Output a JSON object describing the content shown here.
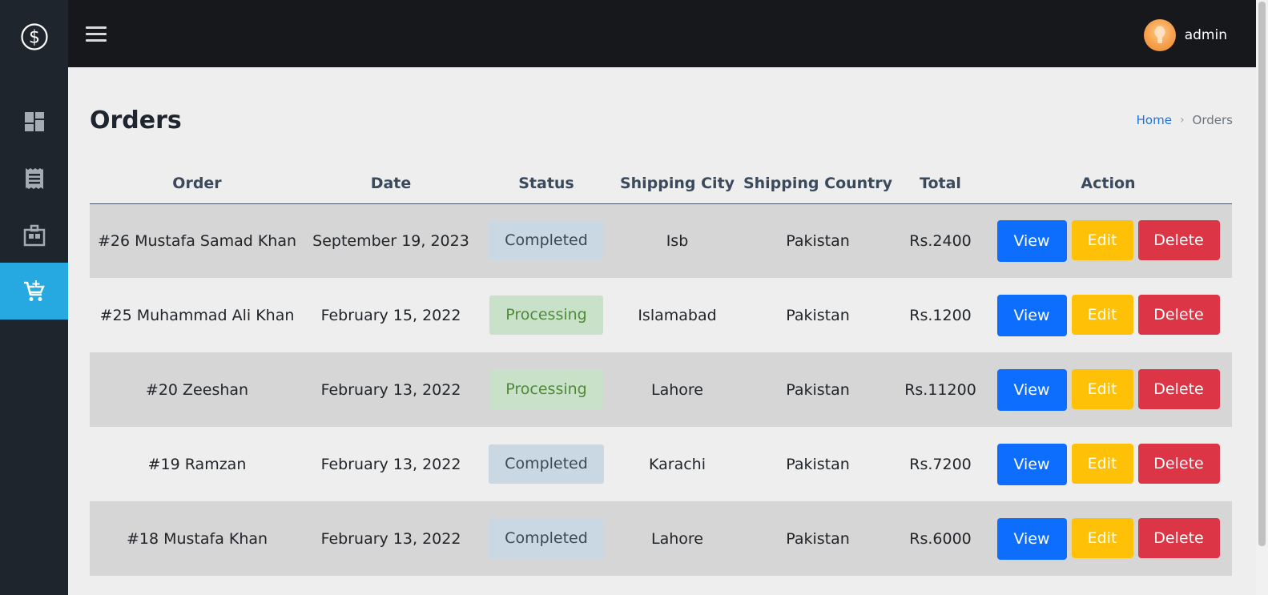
{
  "colors": {
    "sidebar": "#1f252d",
    "sidebar_active": "#26a9e0",
    "topbar": "#16181c",
    "view_button": "#0d6efd",
    "edit_button": "#ffc107",
    "delete_button": "#dc3545",
    "completed_badge": "#c9d8e3",
    "processing_badge": "#c9e1c9"
  },
  "sidebar": {
    "logo_icon": "dollar-circle-icon",
    "items": [
      {
        "icon": "dashboard-icon",
        "active": false
      },
      {
        "icon": "receipt-icon",
        "active": false
      },
      {
        "icon": "store-icon",
        "active": false
      },
      {
        "icon": "cart-add-icon",
        "active": true
      }
    ]
  },
  "header": {
    "menu_icon": "hamburger-icon",
    "user_name": "admin"
  },
  "page": {
    "title": "Orders"
  },
  "breadcrumb": {
    "home": "Home",
    "current": "Orders"
  },
  "table": {
    "columns": [
      "Order",
      "Date",
      "Status",
      "Shipping City",
      "Shipping Country",
      "Total",
      "Action"
    ],
    "rows": [
      {
        "order": "#26 Mustafa Samad Khan",
        "date": "September 19, 2023",
        "status": "Completed",
        "city": "Isb",
        "country": "Pakistan",
        "total": "Rs.2400"
      },
      {
        "order": "#25 Muhammad Ali Khan",
        "date": "February 15, 2022",
        "status": "Processing",
        "city": "Islamabad",
        "country": "Pakistan",
        "total": "Rs.1200"
      },
      {
        "order": "#20 Zeeshan",
        "date": "February 13, 2022",
        "status": "Processing",
        "city": "Lahore",
        "country": "Pakistan",
        "total": "Rs.11200"
      },
      {
        "order": "#19 Ramzan",
        "date": "February 13, 2022",
        "status": "Completed",
        "city": "Karachi",
        "country": "Pakistan",
        "total": "Rs.7200"
      },
      {
        "order": "#18 Mustafa Khan",
        "date": "February 13, 2022",
        "status": "Completed",
        "city": "Lahore",
        "country": "Pakistan",
        "total": "Rs.6000"
      }
    ],
    "actions": {
      "view": "View",
      "edit": "Edit",
      "delete": "Delete"
    }
  }
}
